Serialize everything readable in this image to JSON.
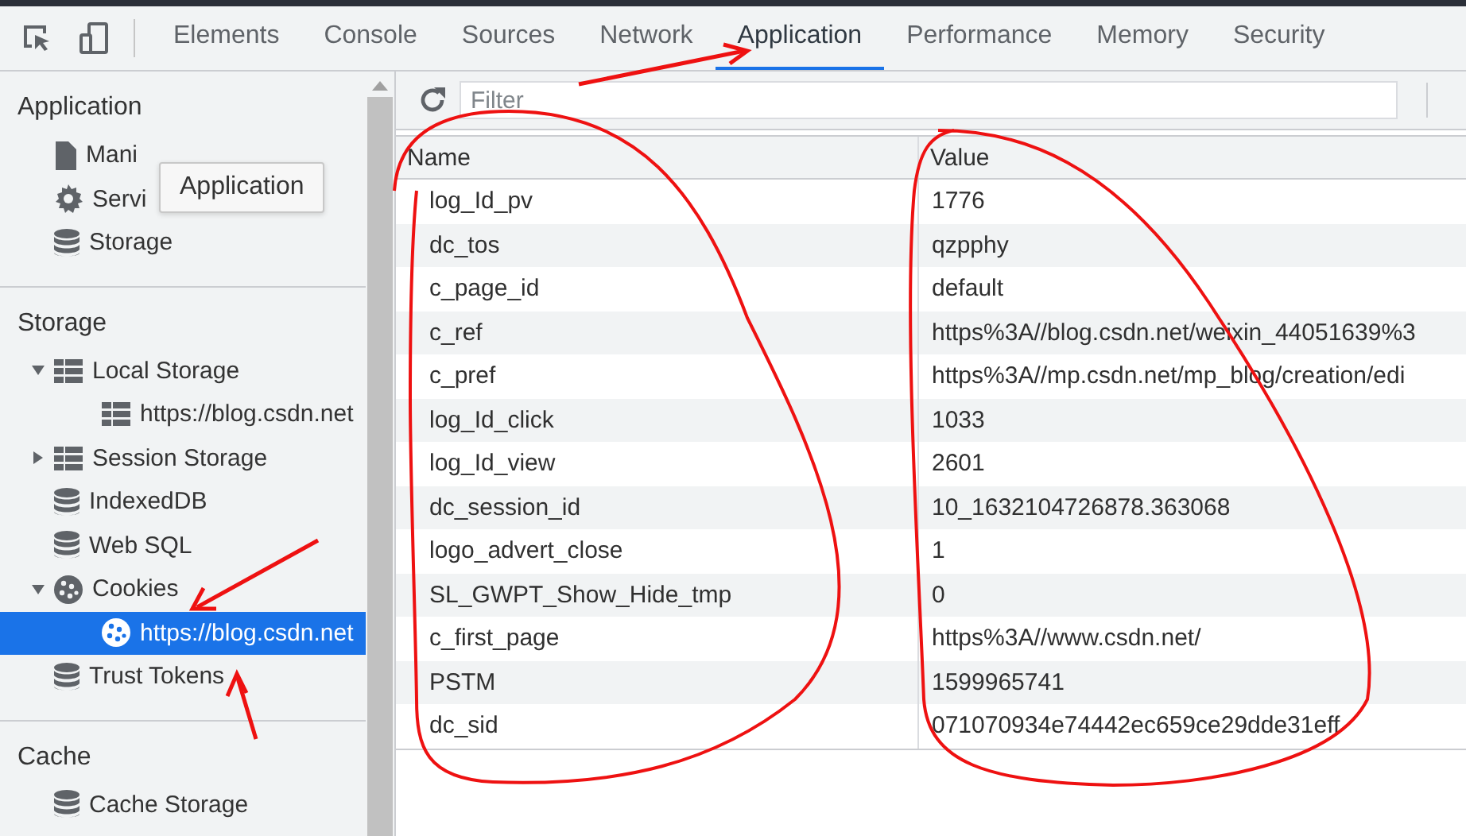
{
  "toolbar": {
    "tabs": [
      {
        "label": "Elements",
        "selected": false
      },
      {
        "label": "Console",
        "selected": false
      },
      {
        "label": "Sources",
        "selected": false
      },
      {
        "label": "Network",
        "selected": false
      },
      {
        "label": "Application",
        "selected": true
      },
      {
        "label": "Performance",
        "selected": false
      },
      {
        "label": "Memory",
        "selected": false
      },
      {
        "label": "Security",
        "selected": false
      }
    ]
  },
  "sidebar": {
    "sections": [
      {
        "title": "Application",
        "items": [
          {
            "label": "Mani",
            "kind": "file",
            "selected": false
          },
          {
            "label": "Servi",
            "kind": "gear",
            "selected": false
          },
          {
            "label": "Storage",
            "kind": "database",
            "selected": false
          }
        ]
      },
      {
        "title": "Storage",
        "items": [
          {
            "label": "Local Storage",
            "kind": "grid",
            "expanded": true,
            "selected": false,
            "children": [
              {
                "label": "https://blog.csdn.net",
                "kind": "grid",
                "selected": false
              }
            ]
          },
          {
            "label": "Session Storage",
            "kind": "grid",
            "expanded": false,
            "selected": false
          },
          {
            "label": "IndexedDB",
            "kind": "database",
            "selected": false
          },
          {
            "label": "Web SQL",
            "kind": "database",
            "selected": false
          },
          {
            "label": "Cookies",
            "kind": "cookie",
            "expanded": true,
            "selected": false,
            "children": [
              {
                "label": "https://blog.csdn.net",
                "kind": "cookie",
                "selected": true
              }
            ]
          },
          {
            "label": "Trust Tokens",
            "kind": "database",
            "selected": false
          }
        ]
      },
      {
        "title": "Cache",
        "items": [
          {
            "label": "Cache Storage",
            "kind": "database",
            "selected": false
          }
        ]
      }
    ],
    "tooltip": "Application"
  },
  "filter": {
    "placeholder": "Filter"
  },
  "table": {
    "columns": [
      "Name",
      "Value"
    ],
    "rows": [
      [
        "log_Id_pv",
        "1776"
      ],
      [
        "dc_tos",
        "qzpphy"
      ],
      [
        "c_page_id",
        "default"
      ],
      [
        "c_ref",
        "https%3A//blog.csdn.net/weixin_44051639%3"
      ],
      [
        "c_pref",
        "https%3A//mp.csdn.net/mp_blog/creation/edi"
      ],
      [
        "log_Id_click",
        "1033"
      ],
      [
        "log_Id_view",
        "2601"
      ],
      [
        "dc_session_id",
        "10_1632104726878.363068"
      ],
      [
        "logo_advert_close",
        "1"
      ],
      [
        "SL_GWPT_Show_Hide_tmp",
        "0"
      ],
      [
        "c_first_page",
        "https%3A//www.csdn.net/"
      ],
      [
        "PSTM",
        "1599965741"
      ],
      [
        "dc_sid",
        "071070934e74442ec659ce29dde31eff"
      ]
    ]
  }
}
